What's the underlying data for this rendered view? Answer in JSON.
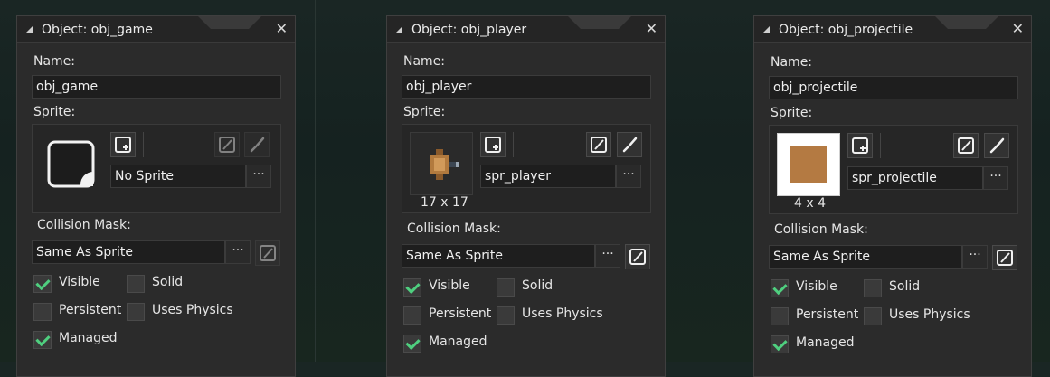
{
  "panels": [
    {
      "title": "Object: obj_game",
      "name_label": "Name:",
      "name_value": "obj_game",
      "sprite_label": "Sprite:",
      "sprite_value": "No Sprite",
      "sprite_size": "",
      "mask_label": "Collision Mask:",
      "mask_value": "Same As Sprite",
      "checkboxes": {
        "visible": {
          "label": "Visible",
          "checked": true
        },
        "solid": {
          "label": "Solid",
          "checked": false
        },
        "persistent": {
          "label": "Persistent",
          "checked": false
        },
        "uses_physics": {
          "label": "Uses Physics",
          "checked": false
        },
        "managed": {
          "label": "Managed",
          "checked": true
        }
      }
    },
    {
      "title": "Object: obj_player",
      "name_label": "Name:",
      "name_value": "obj_player",
      "sprite_label": "Sprite:",
      "sprite_value": "spr_player",
      "sprite_size": "17 x 17",
      "mask_label": "Collision Mask:",
      "mask_value": "Same As Sprite",
      "checkboxes": {
        "visible": {
          "label": "Visible",
          "checked": true
        },
        "solid": {
          "label": "Solid",
          "checked": false
        },
        "persistent": {
          "label": "Persistent",
          "checked": false
        },
        "uses_physics": {
          "label": "Uses Physics",
          "checked": false
        },
        "managed": {
          "label": "Managed",
          "checked": true
        }
      }
    },
    {
      "title": "Object: obj_projectile",
      "name_label": "Name:",
      "name_value": "obj_projectile",
      "sprite_label": "Sprite:",
      "sprite_value": "spr_projectile",
      "sprite_size": "4 x 4",
      "mask_label": "Collision Mask:",
      "mask_value": "Same As Sprite",
      "checkboxes": {
        "visible": {
          "label": "Visible",
          "checked": true
        },
        "solid": {
          "label": "Solid",
          "checked": false
        },
        "persistent": {
          "label": "Persistent",
          "checked": false
        },
        "uses_physics": {
          "label": "Uses Physics",
          "checked": false
        },
        "managed": {
          "label": "Managed",
          "checked": true
        }
      }
    }
  ],
  "ui": {
    "close_glyph": "✕",
    "ellipsis": "···",
    "accent_check": "#4fcf7f"
  }
}
